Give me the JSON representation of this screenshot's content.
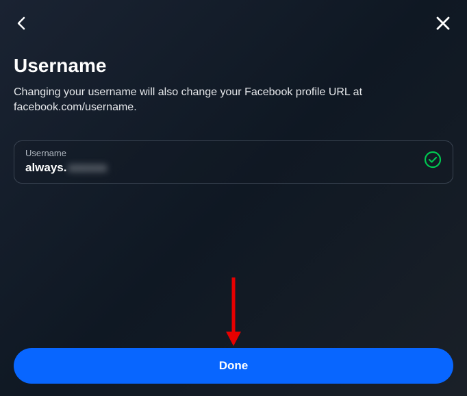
{
  "header": {
    "title": "Username"
  },
  "description": "Changing your username will also change your Facebook profile URL at facebook.com/username.",
  "input": {
    "label": "Username",
    "value_visible": "always.",
    "value_obscured": "xxxxxx"
  },
  "button": {
    "done_label": "Done"
  },
  "colors": {
    "primary": "#0866ff",
    "success": "#00c851"
  }
}
